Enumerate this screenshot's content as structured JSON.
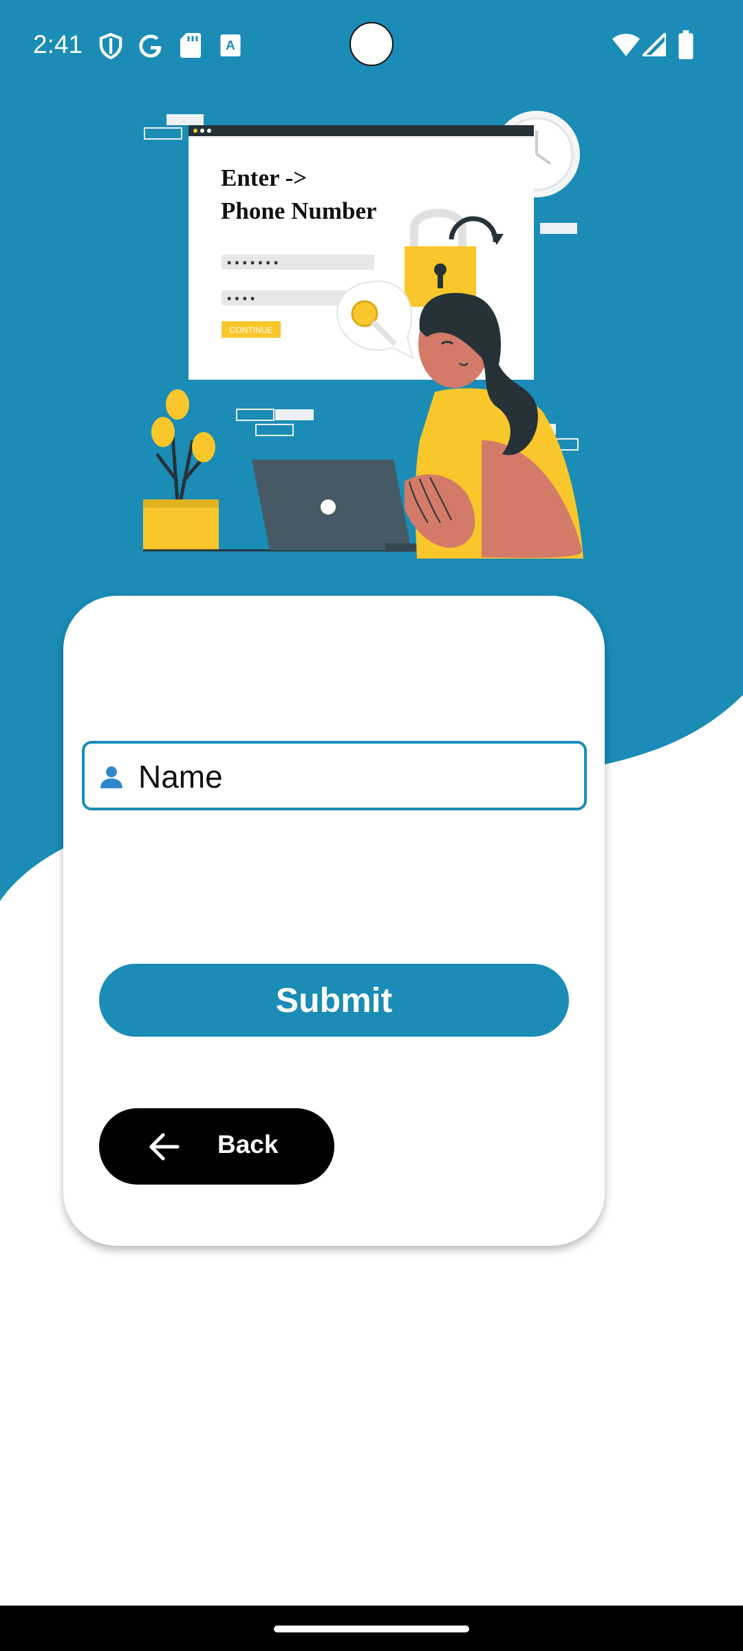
{
  "status_bar": {
    "time": "2:41",
    "icons": [
      "shield-icon",
      "google-icon",
      "sd-card-icon",
      "keyboard-a-icon",
      "wifi-icon",
      "signal-icon",
      "battery-icon"
    ]
  },
  "illustration": {
    "title_line1": "Enter   ->",
    "title_line2": "Phone Number",
    "dots_field1": "• • • • • • •",
    "dots_field2": "• • • •",
    "continue_label": "CONTINUE"
  },
  "form": {
    "name_placeholder": "Name",
    "submit_label": "Submit",
    "back_label": "Back"
  },
  "colors": {
    "primary": "#1a8cb6",
    "background_wave": "#1a8cb6",
    "back_button": "#000000",
    "accent_yellow": "#f9c72b"
  }
}
